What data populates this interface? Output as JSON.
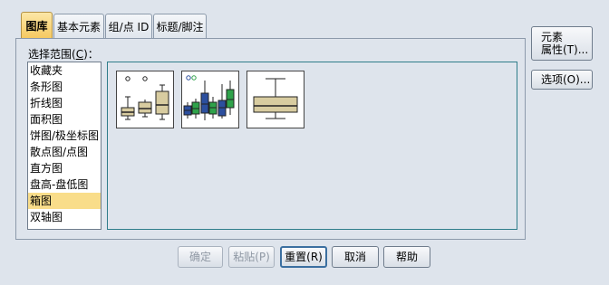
{
  "tabs": [
    {
      "label": "图库",
      "active": true
    },
    {
      "label": "基本元素",
      "active": false
    },
    {
      "label": "组/点 ID",
      "active": false
    },
    {
      "label": "标题/脚注",
      "active": false
    }
  ],
  "gallery": {
    "choose_label_prefix": "选择范围(",
    "choose_label_key": "C",
    "choose_label_suffix": ")：",
    "items": [
      "收藏夹",
      "条形图",
      "折线图",
      "面积图",
      "饼图/极坐标图",
      "散点图/点图",
      "直方图",
      "盘高-盘低图",
      "箱图",
      "双轴图"
    ],
    "selected": "箱图",
    "thumbnails": [
      {
        "icon": "simple-boxplot-icon"
      },
      {
        "icon": "clustered-boxplot-icon"
      },
      {
        "icon": "1d-boxplot-icon"
      }
    ]
  },
  "side_buttons": {
    "element_props_line1": "元素",
    "element_props_line2": "属性(T)...",
    "options": "选项(O)..."
  },
  "bottom_buttons": {
    "ok": "确定",
    "paste": "粘贴(P)",
    "reset": "重置(R)",
    "cancel": "取消",
    "help": "帮助"
  },
  "colors": {
    "active_tab": "#f6c75c",
    "selected_item": "#f9dd8a",
    "box_tan": "#d8cca0",
    "box_blue": "#2c4f9e",
    "box_green": "#2fa24a"
  }
}
